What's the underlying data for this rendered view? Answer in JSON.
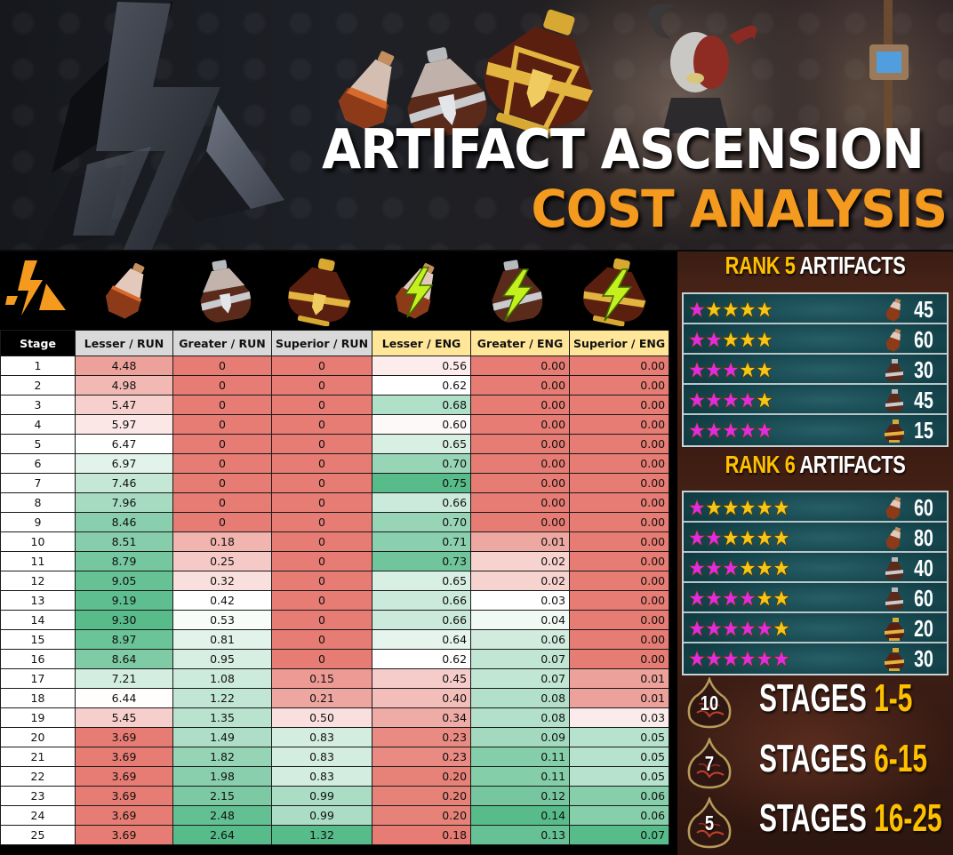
{
  "header": {
    "title_line1": "ARTIFACT ASCENSION",
    "title_line2": "COST ANALYSIS",
    "title_line1_color": "#ffffff",
    "title_line2_color": "#f39a1f"
  },
  "brand": {
    "logo": "hellhades-lightning-logo",
    "accent": "#f39a1f"
  },
  "table": {
    "columns": [
      {
        "key": "stage",
        "label": "Stage",
        "icon": null
      },
      {
        "key": "lesser_run",
        "label": "Lesser / RUN",
        "icon": "lesser-ascension-potion-icon"
      },
      {
        "key": "greater_run",
        "label": "Greater / RUN",
        "icon": "greater-ascension-potion-icon"
      },
      {
        "key": "superior_run",
        "label": "Superior / RUN",
        "icon": "superior-ascension-potion-icon"
      },
      {
        "key": "lesser_eng",
        "label": "Lesser / ENG",
        "icon": "lesser-energy-potion-icon"
      },
      {
        "key": "greater_eng",
        "label": "Greater / ENG",
        "icon": "greater-energy-potion-icon"
      },
      {
        "key": "superior_eng",
        "label": "Superior / ENG",
        "icon": "superior-energy-potion-icon"
      }
    ],
    "header_colors": {
      "stage": "#000000",
      "run": "#d9d9d9",
      "eng": "#ffe699"
    },
    "scale_colors": {
      "low": "#e67c73",
      "mid": "#ffffff",
      "high": "#57bb8a"
    },
    "rows": [
      {
        "stage": "1",
        "lesser_run": "4.48",
        "greater_run": "0",
        "superior_run": "0",
        "lesser_eng": "0.56",
        "greater_eng": "0.00",
        "superior_eng": "0.00"
      },
      {
        "stage": "2",
        "lesser_run": "4.98",
        "greater_run": "0",
        "superior_run": "0",
        "lesser_eng": "0.62",
        "greater_eng": "0.00",
        "superior_eng": "0.00"
      },
      {
        "stage": "3",
        "lesser_run": "5.47",
        "greater_run": "0",
        "superior_run": "0",
        "lesser_eng": "0.68",
        "greater_eng": "0.00",
        "superior_eng": "0.00"
      },
      {
        "stage": "4",
        "lesser_run": "5.97",
        "greater_run": "0",
        "superior_run": "0",
        "lesser_eng": "0.60",
        "greater_eng": "0.00",
        "superior_eng": "0.00"
      },
      {
        "stage": "5",
        "lesser_run": "6.47",
        "greater_run": "0",
        "superior_run": "0",
        "lesser_eng": "0.65",
        "greater_eng": "0.00",
        "superior_eng": "0.00"
      },
      {
        "stage": "6",
        "lesser_run": "6.97",
        "greater_run": "0",
        "superior_run": "0",
        "lesser_eng": "0.70",
        "greater_eng": "0.00",
        "superior_eng": "0.00"
      },
      {
        "stage": "7",
        "lesser_run": "7.46",
        "greater_run": "0",
        "superior_run": "0",
        "lesser_eng": "0.75",
        "greater_eng": "0.00",
        "superior_eng": "0.00"
      },
      {
        "stage": "8",
        "lesser_run": "7.96",
        "greater_run": "0",
        "superior_run": "0",
        "lesser_eng": "0.66",
        "greater_eng": "0.00",
        "superior_eng": "0.00"
      },
      {
        "stage": "9",
        "lesser_run": "8.46",
        "greater_run": "0",
        "superior_run": "0",
        "lesser_eng": "0.70",
        "greater_eng": "0.00",
        "superior_eng": "0.00"
      },
      {
        "stage": "10",
        "lesser_run": "8.51",
        "greater_run": "0.18",
        "superior_run": "0",
        "lesser_eng": "0.71",
        "greater_eng": "0.01",
        "superior_eng": "0.00"
      },
      {
        "stage": "11",
        "lesser_run": "8.79",
        "greater_run": "0.25",
        "superior_run": "0",
        "lesser_eng": "0.73",
        "greater_eng": "0.02",
        "superior_eng": "0.00"
      },
      {
        "stage": "12",
        "lesser_run": "9.05",
        "greater_run": "0.32",
        "superior_run": "0",
        "lesser_eng": "0.65",
        "greater_eng": "0.02",
        "superior_eng": "0.00"
      },
      {
        "stage": "13",
        "lesser_run": "9.19",
        "greater_run": "0.42",
        "superior_run": "0",
        "lesser_eng": "0.66",
        "greater_eng": "0.03",
        "superior_eng": "0.00"
      },
      {
        "stage": "14",
        "lesser_run": "9.30",
        "greater_run": "0.53",
        "superior_run": "0",
        "lesser_eng": "0.66",
        "greater_eng": "0.04",
        "superior_eng": "0.00"
      },
      {
        "stage": "15",
        "lesser_run": "8.97",
        "greater_run": "0.81",
        "superior_run": "0",
        "lesser_eng": "0.64",
        "greater_eng": "0.06",
        "superior_eng": "0.00"
      },
      {
        "stage": "16",
        "lesser_run": "8.64",
        "greater_run": "0.95",
        "superior_run": "0",
        "lesser_eng": "0.62",
        "greater_eng": "0.07",
        "superior_eng": "0.00"
      },
      {
        "stage": "17",
        "lesser_run": "7.21",
        "greater_run": "1.08",
        "superior_run": "0.15",
        "lesser_eng": "0.45",
        "greater_eng": "0.07",
        "superior_eng": "0.01"
      },
      {
        "stage": "18",
        "lesser_run": "6.44",
        "greater_run": "1.22",
        "superior_run": "0.21",
        "lesser_eng": "0.40",
        "greater_eng": "0.08",
        "superior_eng": "0.01"
      },
      {
        "stage": "19",
        "lesser_run": "5.45",
        "greater_run": "1.35",
        "superior_run": "0.50",
        "lesser_eng": "0.34",
        "greater_eng": "0.08",
        "superior_eng": "0.03"
      },
      {
        "stage": "20",
        "lesser_run": "3.69",
        "greater_run": "1.49",
        "superior_run": "0.83",
        "lesser_eng": "0.23",
        "greater_eng": "0.09",
        "superior_eng": "0.05"
      },
      {
        "stage": "21",
        "lesser_run": "3.69",
        "greater_run": "1.82",
        "superior_run": "0.83",
        "lesser_eng": "0.23",
        "greater_eng": "0.11",
        "superior_eng": "0.05"
      },
      {
        "stage": "22",
        "lesser_run": "3.69",
        "greater_run": "1.98",
        "superior_run": "0.83",
        "lesser_eng": "0.20",
        "greater_eng": "0.11",
        "superior_eng": "0.05"
      },
      {
        "stage": "23",
        "lesser_run": "3.69",
        "greater_run": "2.15",
        "superior_run": "0.99",
        "lesser_eng": "0.20",
        "greater_eng": "0.12",
        "superior_eng": "0.06"
      },
      {
        "stage": "24",
        "lesser_run": "3.69",
        "greater_run": "2.48",
        "superior_run": "0.99",
        "lesser_eng": "0.20",
        "greater_eng": "0.14",
        "superior_eng": "0.06"
      },
      {
        "stage": "25",
        "lesser_run": "3.69",
        "greater_run": "2.64",
        "superior_run": "1.32",
        "lesser_eng": "0.18",
        "greater_eng": "0.13",
        "superior_eng": "0.07"
      }
    ]
  },
  "panel": {
    "rank5": {
      "title_highlight": "RANK 5",
      "title_rest": "ARTIFACTS",
      "rows": [
        {
          "ascended": 1,
          "total": 5,
          "potion": "lesser",
          "count": "45"
        },
        {
          "ascended": 2,
          "total": 5,
          "potion": "lesser",
          "count": "60"
        },
        {
          "ascended": 3,
          "total": 5,
          "potion": "greater",
          "count": "30"
        },
        {
          "ascended": 4,
          "total": 5,
          "potion": "greater",
          "count": "45"
        },
        {
          "ascended": 5,
          "total": 5,
          "potion": "superior",
          "count": "15"
        }
      ]
    },
    "rank6": {
      "title_highlight": "RANK 6",
      "title_rest": "ARTIFACTS",
      "rows": [
        {
          "ascended": 1,
          "total": 6,
          "potion": "lesser",
          "count": "60"
        },
        {
          "ascended": 2,
          "total": 6,
          "potion": "lesser",
          "count": "80"
        },
        {
          "ascended": 3,
          "total": 6,
          "potion": "greater",
          "count": "40"
        },
        {
          "ascended": 4,
          "total": 6,
          "potion": "greater",
          "count": "60"
        },
        {
          "ascended": 5,
          "total": 6,
          "potion": "superior",
          "count": "20"
        },
        {
          "ascended": 6,
          "total": 6,
          "potion": "superior",
          "count": "30"
        }
      ]
    },
    "star_colors": {
      "ascended": "#e22be0",
      "normal": "#f5c518"
    },
    "keys": [
      {
        "keys": "10",
        "label": "STAGES",
        "range": "1-5"
      },
      {
        "keys": "7",
        "label": "STAGES",
        "range": "6-15"
      },
      {
        "keys": "5",
        "label": "STAGES",
        "range": "16-25"
      }
    ]
  }
}
